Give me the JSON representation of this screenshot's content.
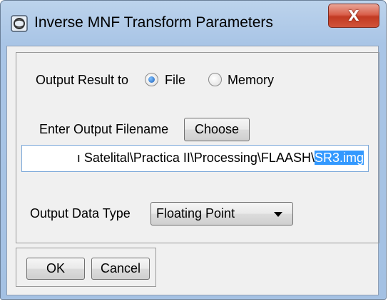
{
  "window": {
    "title": "Inverse MNF Transform Parameters",
    "close_symbol": "X"
  },
  "output_result": {
    "label": "Output Result to",
    "options": [
      "File",
      "Memory"
    ],
    "selected": "File"
  },
  "filename": {
    "label": "Enter Output Filename",
    "choose_label": "Choose",
    "value_unselected": "ı Satelital\\Practica II\\Processing\\FLAASH\\",
    "value_selected": "SR3.img"
  },
  "data_type": {
    "label": "Output Data Type",
    "selected": "Floating Point"
  },
  "buttons": {
    "ok": "OK",
    "cancel": "Cancel"
  },
  "colors": {
    "selection": "#3399ff",
    "close_button": "#c23a22",
    "titlebar": "#a9c5e6"
  }
}
